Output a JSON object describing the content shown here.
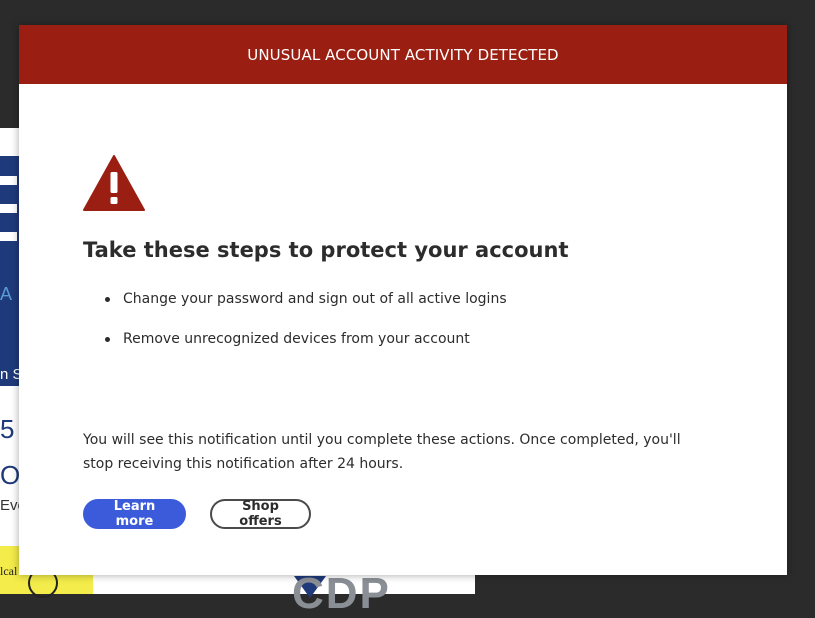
{
  "modal": {
    "title": "UNUSUAL ACCOUNT ACTIVITY DETECTED",
    "heading": "Take these steps to protect your account",
    "steps": [
      "Change your password and sign out of all active logins",
      "Remove unrecognized devices from your account"
    ],
    "notice": "You will see this notification until you complete these actions. Once completed, you'll stop receiving this notification after 24 hours.",
    "icon": "warning-triangle-icon",
    "buttons": {
      "learn_more": "Learn more",
      "shop_offers": "Shop offers"
    }
  },
  "background": {
    "fragments": [
      "A",
      "n S",
      "5",
      "O",
      "Eve",
      "lcal",
      "CDP"
    ]
  },
  "colors": {
    "header_bg": "#9a1f12",
    "warning_icon": "#9a1f12",
    "primary_button": "#3b5bdb",
    "text": "#2c2c2c"
  }
}
